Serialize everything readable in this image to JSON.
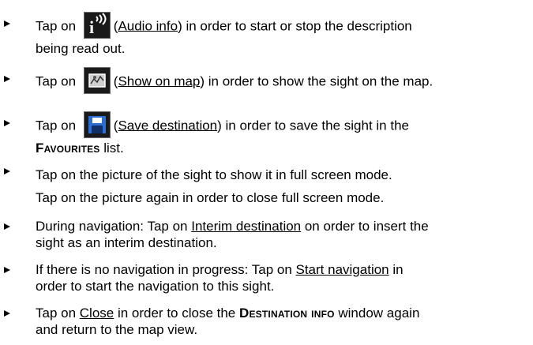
{
  "items": [
    {
      "pre": "Tap on ",
      "icon": "audio-info-icon",
      "link": "Audio info",
      "post_line1": ") in order to start or stop the description",
      "line2": "being read out."
    },
    {
      "pre": "Tap on ",
      "icon": "show-on-map-icon",
      "link": "Show on map",
      "post_line1": ") in order to show the sight on the map."
    },
    {
      "pre": "Tap on ",
      "icon": "save-destination-icon",
      "link": "Save destination",
      "post_line1": ") in order to save the sight in the",
      "line2_sc": "Favourites",
      "line2_post": " list."
    },
    {
      "line1": "Tap on the picture of the sight to show it in full screen mode.",
      "line2": "Tap on the picture again in order to close full screen mode."
    },
    {
      "pre": "During navigation: Tap on ",
      "link": "Interim destination",
      "post_line1": " on order to insert the",
      "line2": "sight as an interim destination."
    },
    {
      "pre": "If there is no navigation in progress: Tap on ",
      "link": "Start navigation",
      "post_line1": " in",
      "line2": "order to start the navigation to this sight."
    },
    {
      "pre": "Tap on ",
      "link": "Close",
      "post_line1a": " in order to close the ",
      "sc": "Destination info",
      "post_line1b": " window again",
      "line2": "and return to the map view."
    }
  ],
  "colors": {
    "text": "#000000",
    "icon_bg": "#1a1a1a",
    "icon_border": "#6b6b6b"
  }
}
